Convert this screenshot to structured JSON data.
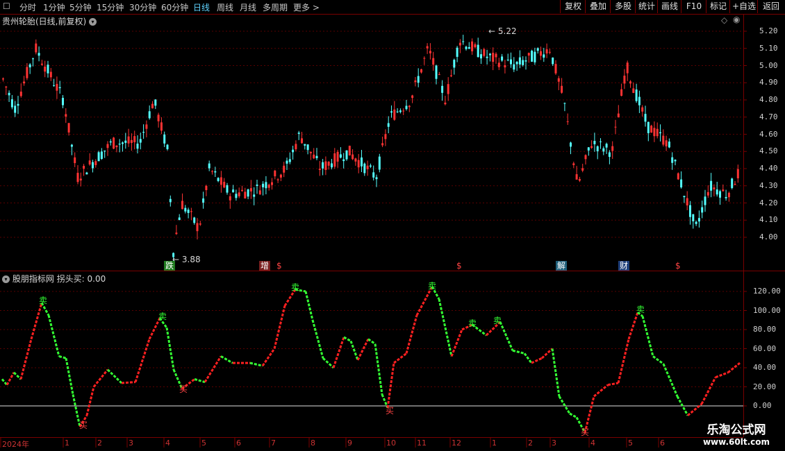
{
  "toolbar": {
    "periods": [
      "分时",
      "1分钟",
      "5分钟",
      "15分钟",
      "30分钟",
      "60分钟",
      "日线",
      "周线",
      "月线",
      "多周期",
      "更多 >"
    ],
    "active_period": "日线",
    "buttons": [
      "复权",
      "叠加",
      "多股",
      "统计",
      "画线",
      "F10",
      "标记",
      "+自选",
      "返回"
    ]
  },
  "main_chart": {
    "title": "贵州轮胎(日线,前复权)",
    "y_ticks": [
      "5.20",
      "5.10",
      "5.00",
      "4.90",
      "4.80",
      "4.70",
      "4.60",
      "4.50",
      "4.40",
      "4.30",
      "4.20",
      "4.10",
      "4.00"
    ],
    "high_label": "5.22",
    "low_label": "3.88",
    "event_markers": [
      {
        "text": "跌",
        "color": "#ffffff",
        "bg": "#1f7a1f"
      },
      {
        "text": "增",
        "color": "#ffffff",
        "bg": "#7a1f1f"
      },
      {
        "text": "$",
        "color": "#ff4444",
        "bg": "transparent"
      },
      {
        "text": "$",
        "color": "#ff4444",
        "bg": "transparent"
      },
      {
        "text": "解",
        "color": "#ffffff",
        "bg": "#1f5f7a"
      },
      {
        "text": "财",
        "color": "#ffffff",
        "bg": "#1f3f7a"
      },
      {
        "text": "$",
        "color": "#ff4444",
        "bg": "transparent"
      }
    ]
  },
  "indicator": {
    "title": "股朋指标网",
    "value_label": "拐头买:",
    "value": "0.00",
    "y_ticks": [
      "120.00",
      "100.00",
      "80.00",
      "60.00",
      "40.00",
      "20.00",
      "0.00"
    ],
    "sell_label": "卖",
    "buy_label": "买"
  },
  "x_axis": [
    "2024年",
    "1",
    "2",
    "3",
    "4",
    "5",
    "6",
    "7",
    "8",
    "9",
    "10",
    "11",
    "12",
    "1",
    "2",
    "3",
    "4",
    "5",
    "6"
  ],
  "watermark": {
    "line1": "乐淘公式网",
    "line2": "www.60lt.com"
  },
  "colors": {
    "up": "#ff3333",
    "down": "#54ffff",
    "grid": "#7a0000",
    "ind_up": "#ff2020",
    "ind_down": "#33ff33"
  }
}
